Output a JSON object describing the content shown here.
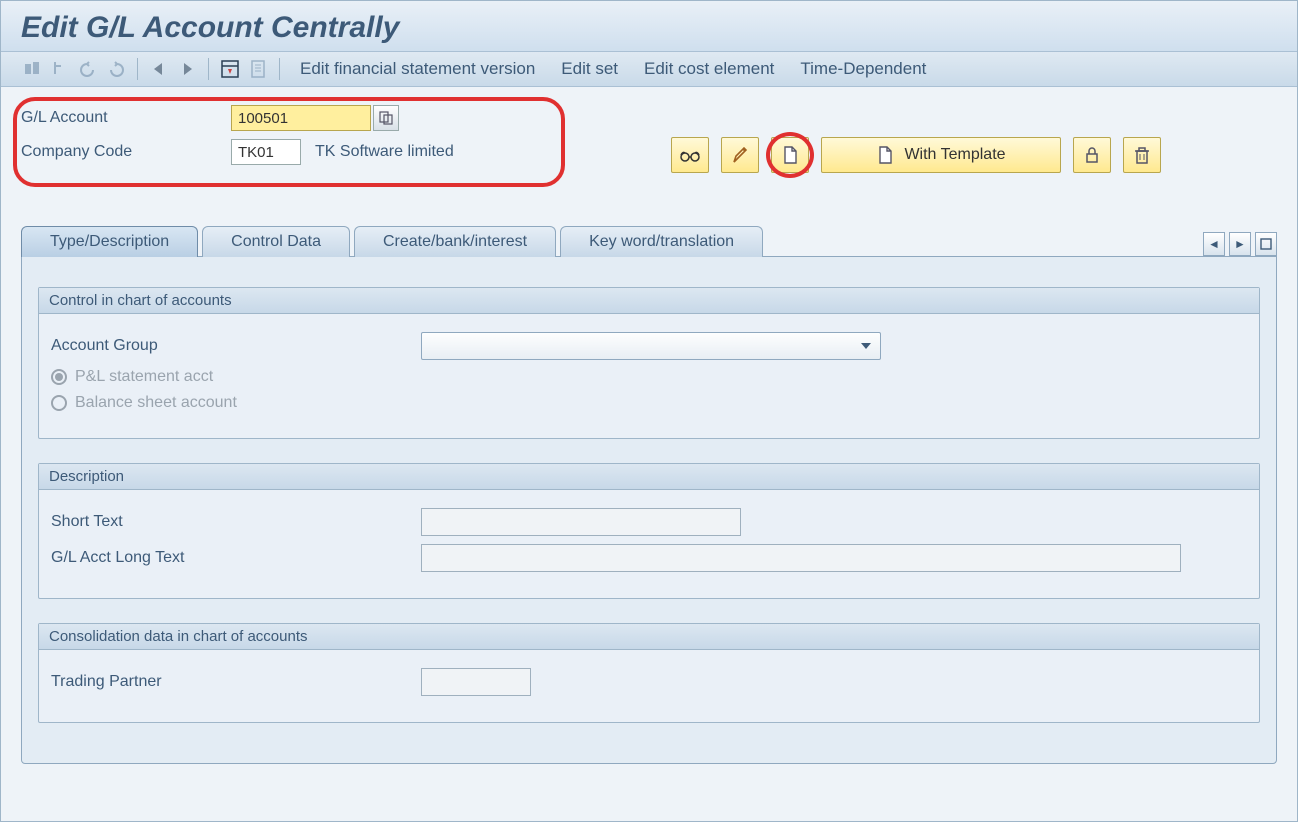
{
  "title": "Edit G/L Account Centrally",
  "toolbar": {
    "links": {
      "fin_version": "Edit financial statement version",
      "edit_set": "Edit set",
      "edit_cost": "Edit cost element",
      "time_dep": "Time-Dependent"
    }
  },
  "header": {
    "gl_label": "G/L Account",
    "gl_value": "100501",
    "cc_label": "Company Code",
    "cc_value": "TK01",
    "cc_text": "TK Software limited"
  },
  "actions": {
    "with_template": "With Template"
  },
  "tabs": {
    "t1": "Type/Description",
    "t2": "Control Data",
    "t3": "Create/bank/interest",
    "t4": "Key word/translation"
  },
  "groups": {
    "control": {
      "title": "Control in chart of accounts",
      "account_group": "Account Group",
      "pl": "P&L statement acct",
      "bs": "Balance sheet account"
    },
    "desc": {
      "title": "Description",
      "short": "Short Text",
      "long": "G/L Acct Long Text"
    },
    "cons": {
      "title": "Consolidation data in chart of accounts",
      "trading": "Trading Partner"
    }
  }
}
